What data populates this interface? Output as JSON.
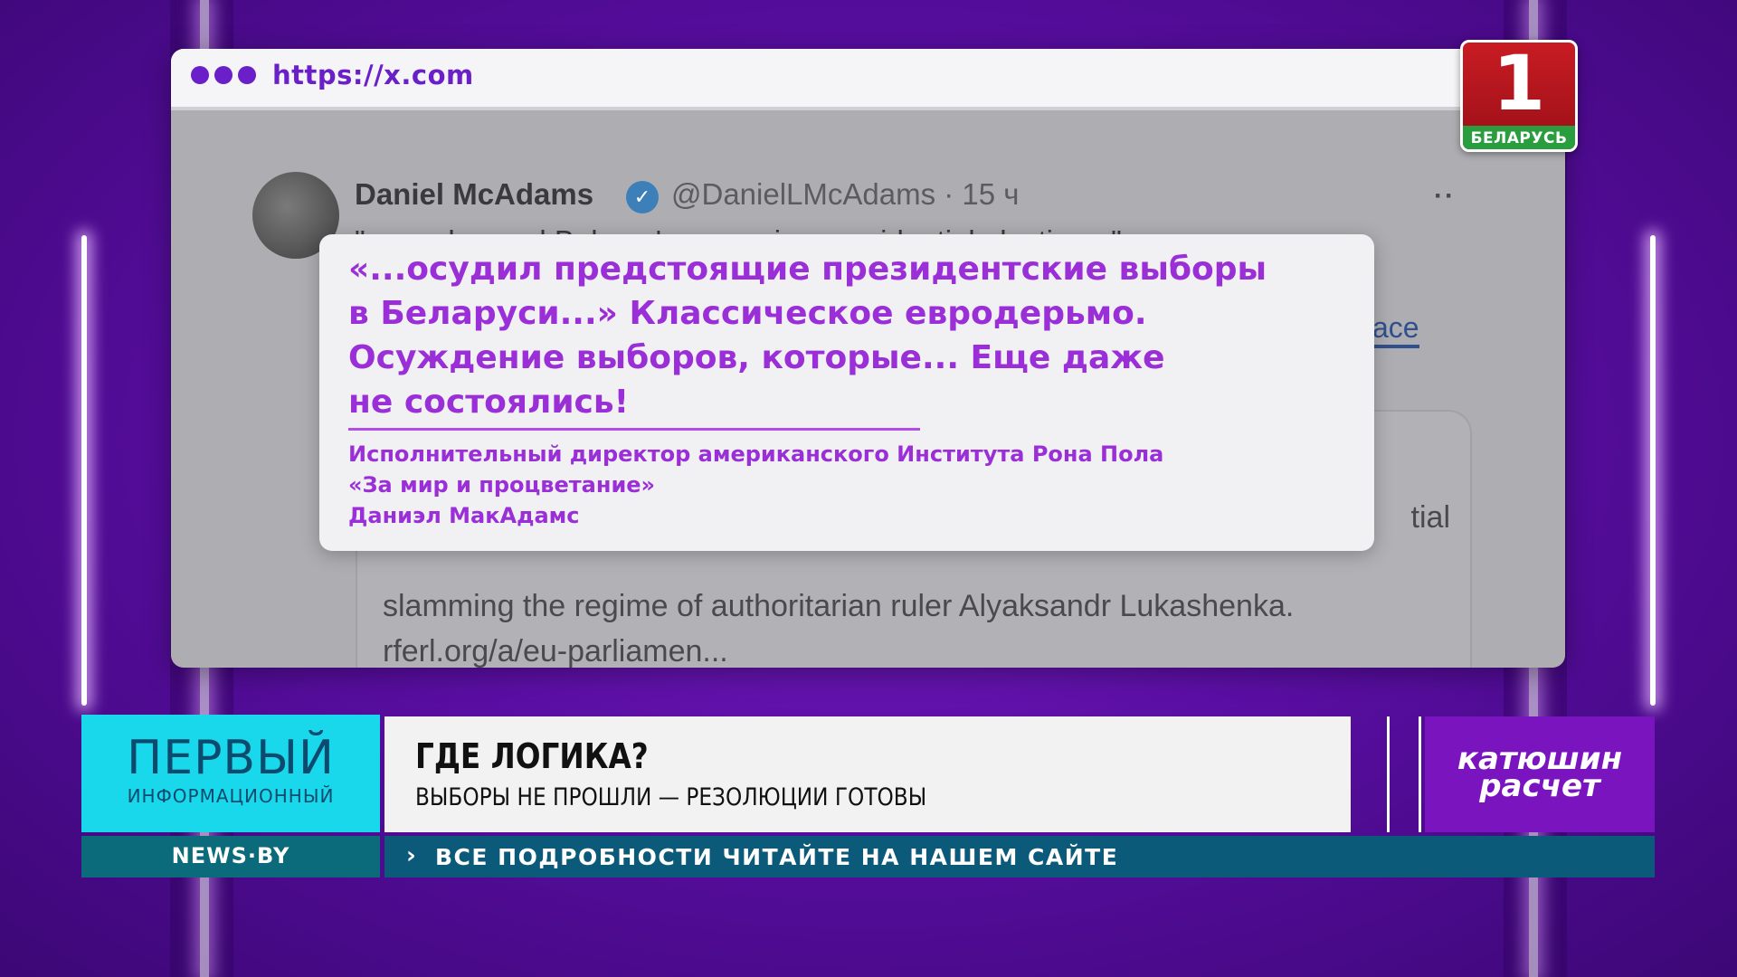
{
  "browser": {
    "url": "https://x.com"
  },
  "tweet": {
    "author_name": "Daniel McAdams",
    "verified_mark": "✓",
    "handle_time": "@DanielLMcAdams · 15 ч",
    "more": "··",
    "text": "\"...condemned Belarus's upcoming presidential election...\"",
    "link_fragment": "ace",
    "card": {
      "fragment": "tial",
      "line1": "slamming the regime of authoritarian ruler Alyaksandr Lukashenka.",
      "line2": "rferl.org/a/eu-parliamen..."
    }
  },
  "quote": {
    "lines": [
      "«...осудил предстоящие президентские выборы",
      "в Беларуси...» Классическое евродерьмо.",
      "Осуждение выборов, которые... Еще даже",
      "не состоялись!"
    ],
    "attribution": [
      "Исполнительный директор американского Института Рона Пола",
      "«За мир и процветание»",
      "Даниэл МакАдамс"
    ]
  },
  "channel_logo": {
    "number": "1",
    "name": "БЕЛАРУСЬ"
  },
  "lower_third": {
    "brand_big": "ПЕРВЫЙ",
    "brand_small": "ИНФОРМАЦИОННЫЙ",
    "headline": "ГДЕ ЛОГИКА?",
    "subhead": "ВЫБОРЫ НЕ ПРОШЛИ — РЕЗОЛЮЦИИ ГОТОВЫ",
    "show_line1": "катюшин",
    "show_line2": "расчет",
    "site": "NEWS·BY",
    "ticker_chevron": "›",
    "ticker": "ВСЕ ПОДРОБНОСТИ ЧИТАЙТЕ НА НАШЕМ САЙТЕ"
  },
  "colors": {
    "accent_purple": "#9a2fd8",
    "brand_cyan": "#19d8ec",
    "ticker_teal": "#0b5a7a",
    "logo_red": "#c81c23",
    "logo_green": "#2a9d3e"
  }
}
